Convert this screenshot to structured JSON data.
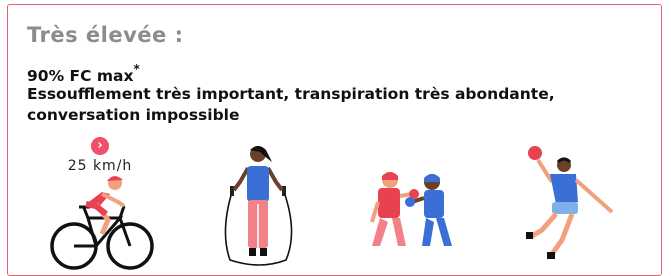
{
  "card": {
    "title": "Très élevée :",
    "heart_rate": "90% FC max",
    "asterisk": "*",
    "line2": "Essoufflement très important, transpiration très abondante,",
    "line3": "conversation impossible"
  },
  "speed": {
    "arrow_icon": "chevron-right-icon",
    "arrow_glyph": "›",
    "value": "25 km/h"
  },
  "colors": {
    "border": "#e8606e",
    "title": "#8c8c8c",
    "accent_red": "#f0506e",
    "blue": "#3a6fd6",
    "coral": "#f2818a"
  }
}
